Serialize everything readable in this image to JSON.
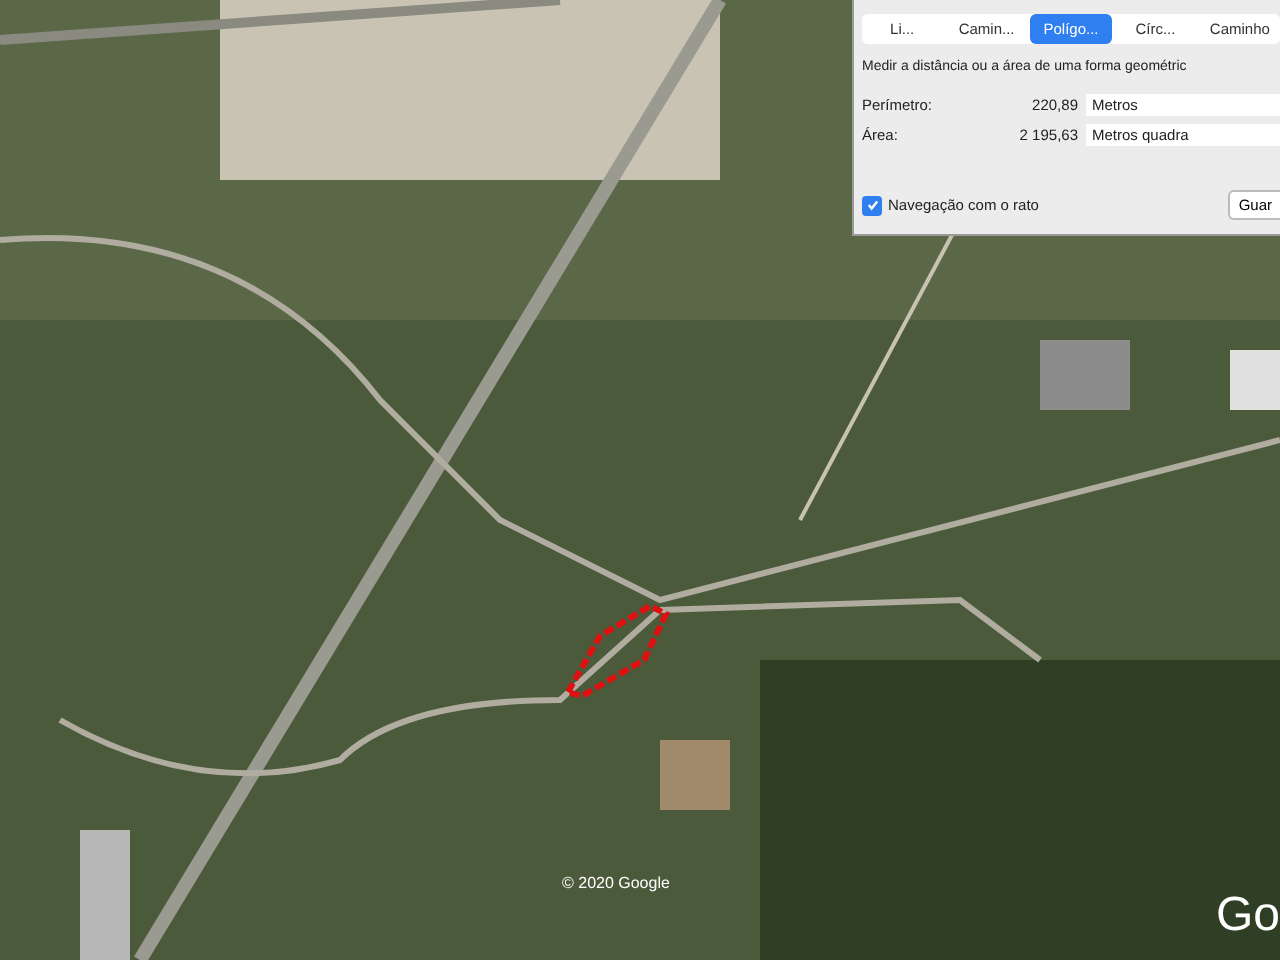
{
  "map": {
    "copyright": "© 2020 Google",
    "logo": "Go"
  },
  "dialog": {
    "tabs": [
      {
        "label": "Li...",
        "selected": false
      },
      {
        "label": "Camin...",
        "selected": false
      },
      {
        "label": "Polígo...",
        "selected": true
      },
      {
        "label": "Círc...",
        "selected": false
      },
      {
        "label": "Caminho",
        "selected": false
      }
    ],
    "instruction": "Medir a distância ou a área de uma forma geométric",
    "measurements": [
      {
        "label": "Perímetro:",
        "value": "220,89",
        "unit": "Metros"
      },
      {
        "label": "Área:",
        "value": "2 195,63",
        "unit": "Metros quadra"
      }
    ],
    "mouse_navigation": {
      "label": "Navegação com o rato",
      "checked": true
    },
    "buttons": [
      "Guar"
    ]
  }
}
